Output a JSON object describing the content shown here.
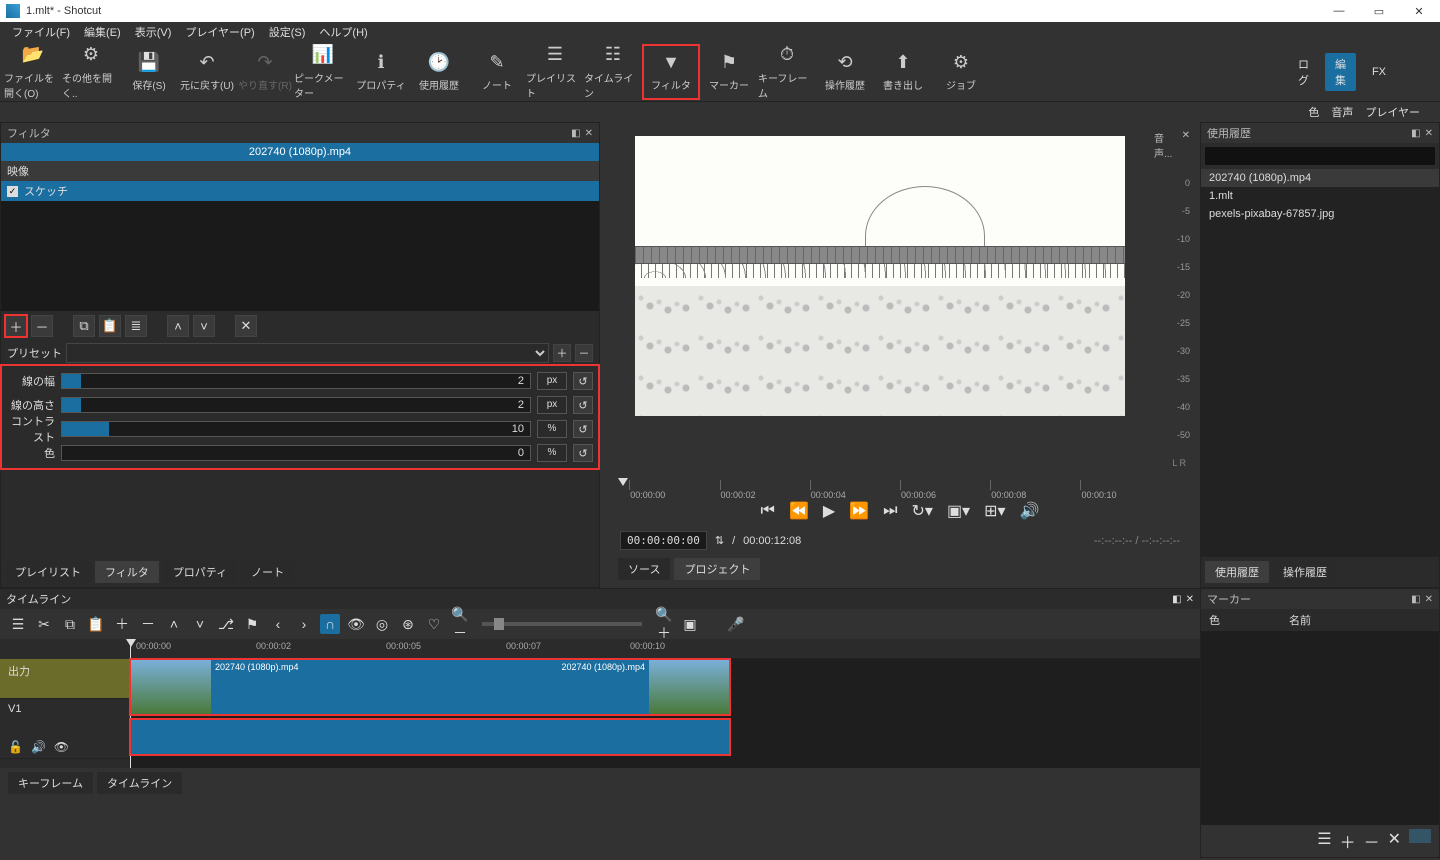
{
  "window": {
    "title": "1.mlt* - Shotcut"
  },
  "menu": {
    "file": "ファイル(F)",
    "edit": "編集(E)",
    "view": "表示(V)",
    "player": "プレイヤー(P)",
    "settings": "設定(S)",
    "help": "ヘルプ(H)"
  },
  "toolbar": {
    "open": "ファイルを開く(O)",
    "open_other": "その他を開く..",
    "save": "保存(S)",
    "undo": "元に戻す(U)",
    "redo": "やり直す(R)",
    "peak": "ピークメーター",
    "props": "プロパティ",
    "recent": "使用履歴",
    "notes": "ノート",
    "playlist": "プレイリスト",
    "timeline": "タイムライン",
    "filter": "フィルタ",
    "marker": "マーカー",
    "keyframes": "キーフレーム",
    "history": "操作履歴",
    "export": "書き出し",
    "jobs": "ジョブ"
  },
  "toolbar_right": {
    "log": "ログ",
    "edit": "編集",
    "fx": "FX",
    "color": "色",
    "audio": "音声",
    "player": "プレイヤー"
  },
  "filter": {
    "panel_title": "フィルタ",
    "clip": "202740 (1080p).mp4",
    "section": "映像",
    "item": "スケッチ",
    "preset_label": "プリセット",
    "params": {
      "line_w": {
        "label": "線の幅",
        "value": "2",
        "unit": "px",
        "fill": 4
      },
      "line_h": {
        "label": "線の高さ",
        "value": "2",
        "unit": "px",
        "fill": 4
      },
      "contrast": {
        "label": "コントラスト",
        "value": "10",
        "unit": "%",
        "fill": 10
      },
      "color": {
        "label": "色",
        "value": "0",
        "unit": "%",
        "fill": 0
      }
    }
  },
  "left_tabs": {
    "playlist": "プレイリスト",
    "filter": "フィルタ",
    "props": "プロパティ",
    "notes": "ノート"
  },
  "preview": {
    "timecode": "00:00:00:00",
    "duration": "00:00:12:08",
    "elapsed": "--:--:--:-- / --:--:--:--",
    "ticks": [
      "00:00:00",
      "00:00:02",
      "00:00:04",
      "00:00:06",
      "00:00:08",
      "00:00:10"
    ],
    "audio_label": "音声...",
    "x_icon": "✕",
    "db": [
      "0",
      "-5",
      "-10",
      "-15",
      "-20",
      "-25",
      "-30",
      "-35",
      "-40",
      "-50"
    ],
    "lr": "L   R"
  },
  "center_tabs": {
    "source": "ソース",
    "project": "プロジェクト"
  },
  "history": {
    "title": "使用履歴",
    "items": [
      "202740 (1080p).mp4",
      "1.mlt",
      "pexels-pixabay-67857.jpg"
    ]
  },
  "right_tabs": {
    "recent": "使用履歴",
    "ops": "操作履歴"
  },
  "marker": {
    "title": "マーカー",
    "col_color": "色",
    "col_name": "名前"
  },
  "timeline": {
    "title": "タイムライン",
    "output": "出力",
    "v1": "V1",
    "ticks": [
      "00:00:00",
      "00:00:02",
      "00:00:05",
      "00:00:07",
      "00:00:10"
    ],
    "clip_a": "202740 (1080p).mp4",
    "clip_b": "202740 (1080p).mp4"
  },
  "bottom_tabs": {
    "keyframes": "キーフレーム",
    "timeline": "タイムライン"
  }
}
